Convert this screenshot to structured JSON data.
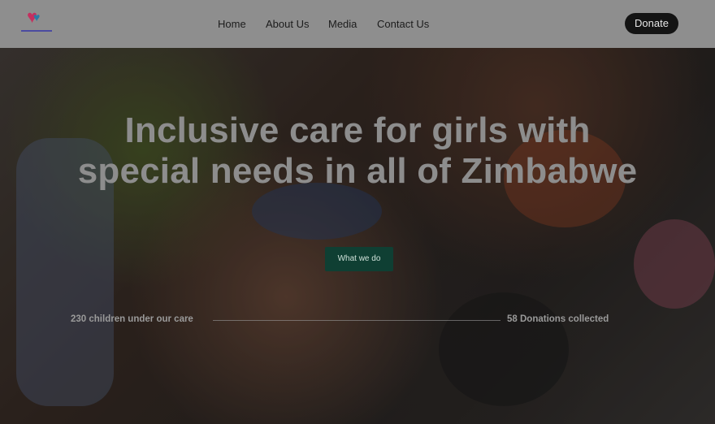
{
  "nav": {
    "items": [
      {
        "label": "Home"
      },
      {
        "label": "About Us"
      },
      {
        "label": "Media"
      },
      {
        "label": "Contact Us"
      }
    ],
    "donate_label": "Donate"
  },
  "hero": {
    "headline_line1": "Inclusive care for girls with",
    "headline_line2": "special needs in all of Zimbabwe",
    "cta_label": "What we do",
    "image_icon": "children-group-photo"
  },
  "stats": {
    "left": "230 children under our care",
    "right": "58 Donations collected"
  },
  "colors": {
    "navbar_bg": "#8e8e8e",
    "donate_bg": "#141414",
    "cta_bg": "#0f3f33",
    "headline": "#8d8d8d"
  }
}
